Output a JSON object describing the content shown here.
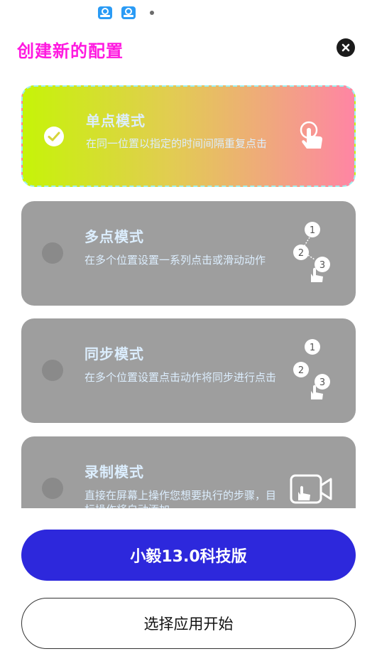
{
  "header": {
    "title": "创建新的配置",
    "close_icon": "close-icon"
  },
  "modes": [
    {
      "title": "单点模式",
      "desc": "在同一位置以指定的时间间隔重复点击",
      "selected": true,
      "icon": "single-tap-icon"
    },
    {
      "title": "多点模式",
      "desc": "在多个位置设置一系列点击或滑动动作",
      "selected": false,
      "icon": "multi-tap-icon"
    },
    {
      "title": "同步模式",
      "desc": "在多个位置设置点击动作将同步进行点击",
      "selected": false,
      "icon": "sync-tap-icon"
    },
    {
      "title": "录制模式",
      "desc": "直接在屏幕上操作您想要执行的步骤，目标操作将自动添加",
      "selected": false,
      "icon": "record-icon"
    }
  ],
  "buttons": {
    "primary": "小毅13.0科技版",
    "secondary": "选择应用开始"
  },
  "colors": {
    "title": "#ff19e0",
    "primary_button": "#2d28dc",
    "card_inactive": "#9e9e9e"
  }
}
